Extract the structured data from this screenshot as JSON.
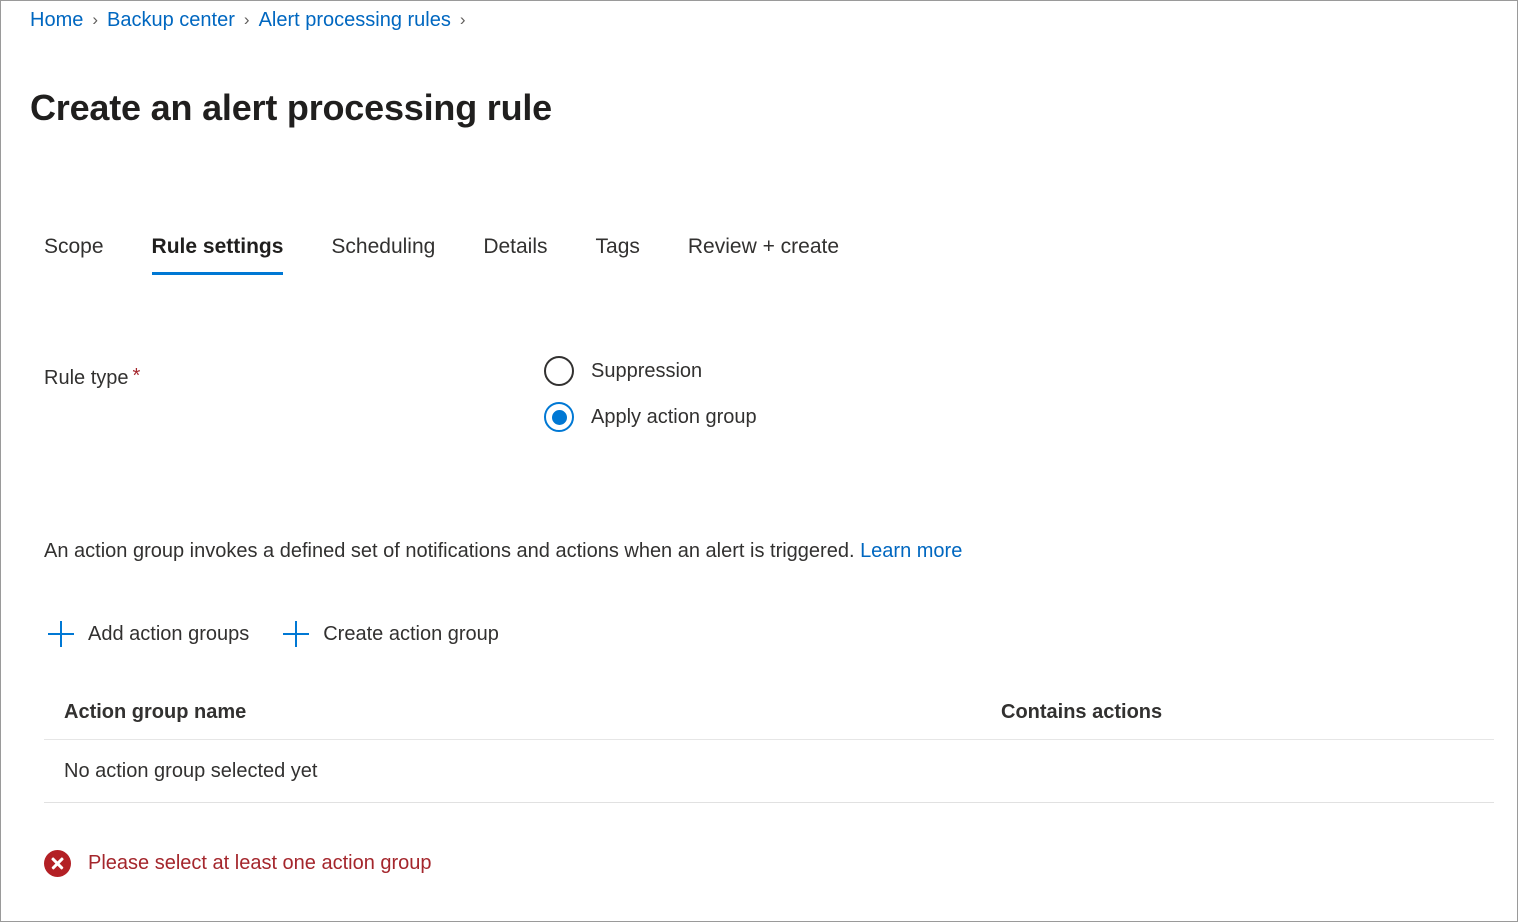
{
  "breadcrumb": {
    "items": [
      {
        "label": "Home",
        "link": true
      },
      {
        "label": "Backup center",
        "link": true
      },
      {
        "label": "Alert processing rules",
        "link": true
      }
    ],
    "separator": "›",
    "trailing_separator": "›"
  },
  "header": {
    "title": "Create an alert processing rule"
  },
  "tabs": [
    {
      "label": "Scope",
      "active": false
    },
    {
      "label": "Rule settings",
      "active": true
    },
    {
      "label": "Scheduling",
      "active": false
    },
    {
      "label": "Details",
      "active": false
    },
    {
      "label": "Tags",
      "active": false
    },
    {
      "label": "Review + create",
      "active": false
    }
  ],
  "rule_type": {
    "label": "Rule type",
    "required_marker": "*",
    "options": [
      {
        "label": "Suppression",
        "selected": false
      },
      {
        "label": "Apply action group",
        "selected": true
      }
    ]
  },
  "description": {
    "text": "An action group invokes a defined set of notifications and actions when an alert is triggered.",
    "link_label": "Learn more"
  },
  "command_bar": {
    "buttons": [
      {
        "label": "Add action groups",
        "icon": "plus-icon"
      },
      {
        "label": "Create action group",
        "icon": "plus-icon"
      }
    ]
  },
  "action_group_grid": {
    "columns": [
      {
        "label": "Action group name"
      },
      {
        "label": "Contains actions"
      }
    ],
    "rows": [
      {
        "name": "No action group selected yet",
        "contains_actions": ""
      }
    ]
  },
  "validation": {
    "icon": "error-circle-x-icon",
    "message": "Please select at least one action group"
  },
  "colors": {
    "accent": "#0078d4",
    "link": "#0067c0",
    "text": "#323130",
    "error": "#a4262c",
    "error_icon": "#b32025",
    "border": "#e1e1e1"
  }
}
